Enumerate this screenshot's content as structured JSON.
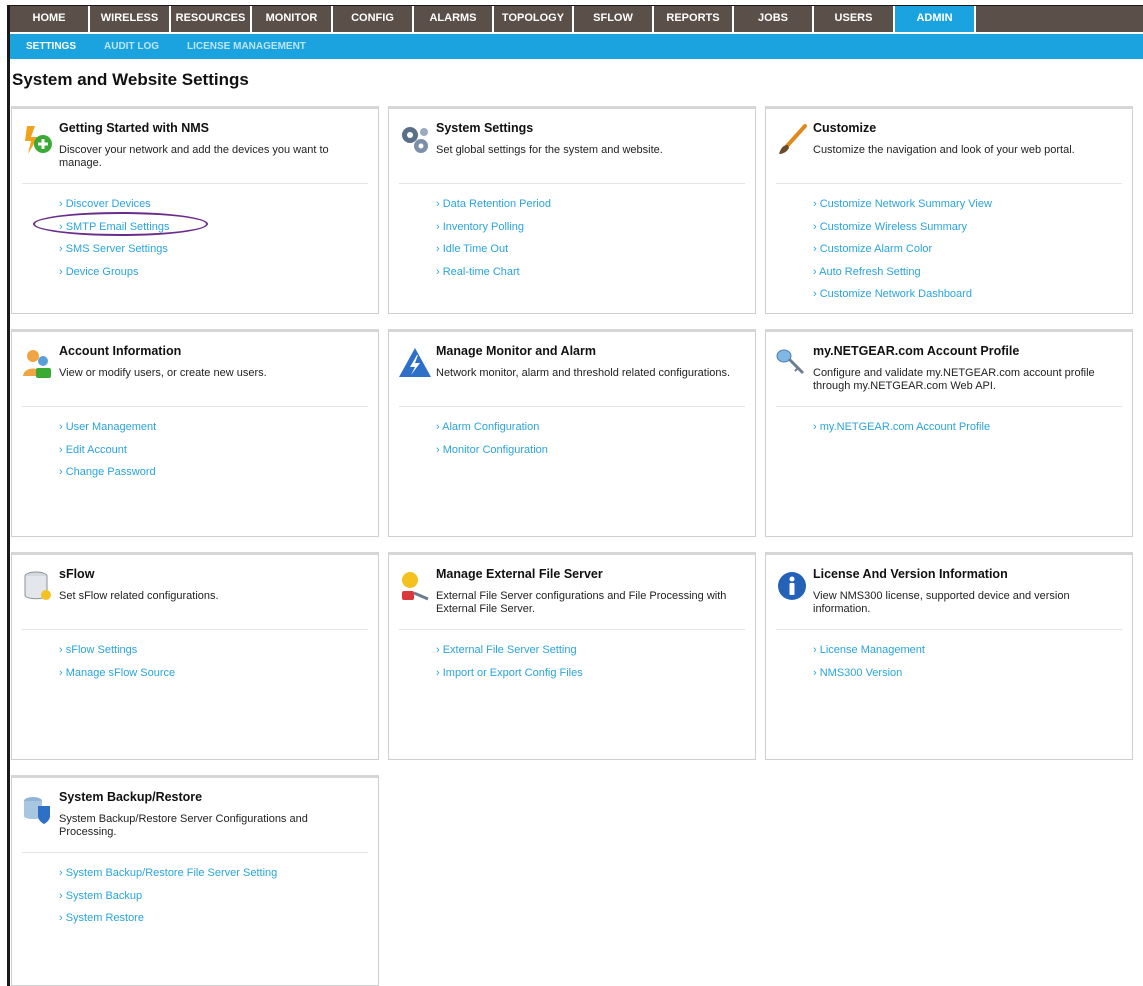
{
  "nav": {
    "tabs": [
      {
        "label": "HOME",
        "width": 80
      },
      {
        "label": "WIRELESS",
        "width": 81
      },
      {
        "label": "RESOURCES",
        "width": 81
      },
      {
        "label": "MONITOR",
        "width": 81
      },
      {
        "label": "CONFIG",
        "width": 81
      },
      {
        "label": "ALARMS",
        "width": 80
      },
      {
        "label": "TOPOLOGY",
        "width": 80
      },
      {
        "label": "SFLOW",
        "width": 80
      },
      {
        "label": "REPORTS",
        "width": 80
      },
      {
        "label": "JOBS",
        "width": 80
      },
      {
        "label": "USERS",
        "width": 81
      },
      {
        "label": "ADMIN",
        "width": 81
      }
    ],
    "active": "ADMIN"
  },
  "subnav": {
    "items": [
      "SETTINGS",
      "AUDIT LOG",
      "LICENSE MANAGEMENT"
    ],
    "active": "SETTINGS"
  },
  "page_title": "System and Website Settings",
  "cards": [
    {
      "title": "Getting Started with NMS",
      "desc": "Discover your network and add the devices you want to manage.",
      "icon": "plus-bolt-icon",
      "links": [
        "Discover Devices",
        "SMTP Email Settings",
        "SMS Server Settings",
        "Device Groups"
      ]
    },
    {
      "title": "System Settings",
      "desc": "Set global settings for the system and website.",
      "icon": "gears-icon",
      "links": [
        "Data Retention Period",
        "Inventory Polling",
        "Idle Time Out",
        "Real-time Chart"
      ]
    },
    {
      "title": "Customize",
      "desc": "Customize the navigation and look of your web portal.",
      "icon": "paintbrush-icon",
      "links": [
        "Customize Network Summary View",
        "Customize Wireless Summary",
        "Customize Alarm Color",
        "Auto Refresh Setting",
        "Customize Network Dashboard"
      ]
    },
    {
      "title": "Account Information",
      "desc": "View or modify users, or create new users.",
      "icon": "users-icon",
      "links": [
        "User Management",
        "Edit Account",
        "Change Password"
      ]
    },
    {
      "title": "Manage Monitor and Alarm",
      "desc": "Network monitor, alarm and threshold related configurations.",
      "icon": "lightning-icon",
      "links": [
        "Alarm Configuration",
        "Monitor Configuration"
      ]
    },
    {
      "title": "my.NETGEAR.com Account Profile",
      "desc": "Configure and validate my.NETGEAR.com account profile through my.NETGEAR.com Web API.",
      "icon": "key-icon",
      "links": [
        "my.NETGEAR.com Account Profile"
      ]
    },
    {
      "title": "sFlow",
      "desc": "Set sFlow related configurations.",
      "icon": "database-icon",
      "links": [
        "sFlow Settings",
        "Manage sFlow Source"
      ]
    },
    {
      "title": "Manage External File Server",
      "desc": "External File Server configurations and File Processing with External File Server.",
      "icon": "file-server-icon",
      "links": [
        "External File Server Setting",
        "Import or Export Config Files"
      ]
    },
    {
      "title": "License And Version Information",
      "desc": "View NMS300 license, supported device and version information.",
      "icon": "info-icon",
      "links": [
        "License Management",
        "NMS300 Version"
      ]
    },
    {
      "title": "System Backup/Restore",
      "desc": "System Backup/Restore Server Configurations and Processing.",
      "icon": "backup-shield-icon",
      "links": [
        "System Backup/Restore File Server Setting",
        "System Backup",
        "System Restore"
      ]
    }
  ],
  "colors": {
    "nav_bg": "#5a4f49",
    "accent": "#1aa3df",
    "link": "#2aa4dc",
    "highlight_oval": "#6a2c8a"
  }
}
